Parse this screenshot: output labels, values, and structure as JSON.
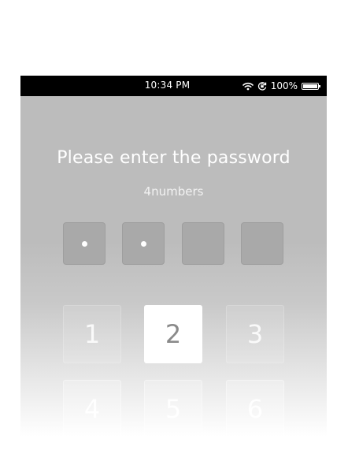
{
  "status_bar": {
    "time": "10:34 PM",
    "battery_percent": "100%",
    "battery_level": 1.0,
    "icons": [
      "wifi-icon",
      "orientation-lock-icon",
      "battery-icon"
    ]
  },
  "lock_screen": {
    "title": "Please enter the password",
    "subtitle": "4numbers",
    "pin_length": 4,
    "digits_entered": 2
  },
  "keypad": {
    "keys": [
      "1",
      "2",
      "3",
      "4",
      "5",
      "6"
    ],
    "pressed_key": "2"
  },
  "colors": {
    "background": "#bcbcbc",
    "status_bar": "#000000",
    "pin_box": "#a9a9a9",
    "pressed_key": "#ffffff"
  }
}
